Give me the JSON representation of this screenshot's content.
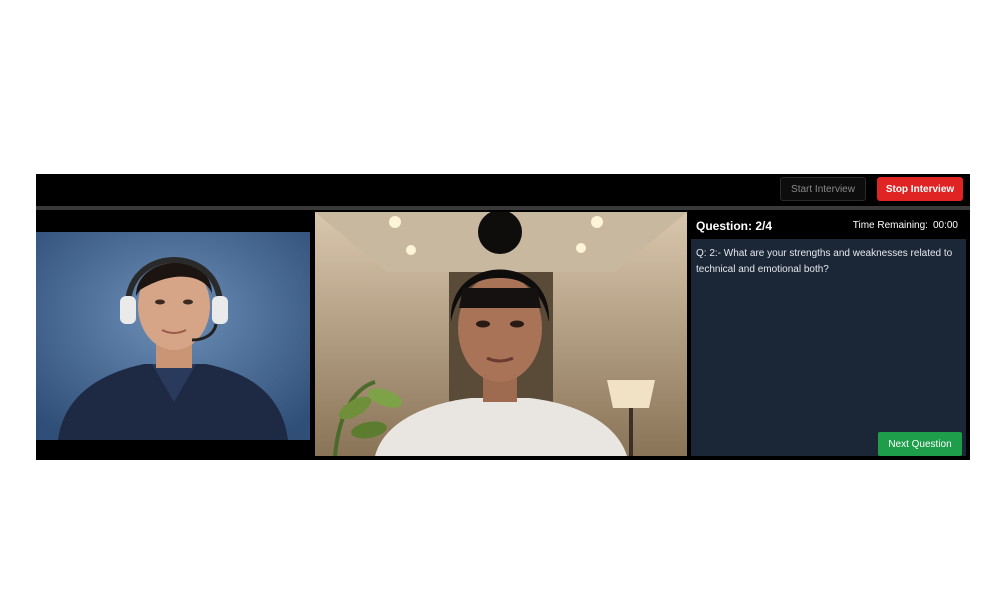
{
  "toolbar": {
    "start_label": "Start Interview",
    "stop_label": "Stop Interview"
  },
  "question_panel": {
    "title": "Question: 2/4",
    "time_label": "Time Remaining:",
    "time_value": "00:00",
    "question_text": "Q: 2:- What are your strengths and weaknesses related to technical and emotional both?",
    "next_label": "Next Question"
  },
  "colors": {
    "stop_button": "#e02424",
    "next_button": "#1e9d4b",
    "panel_bg": "#1b2636"
  }
}
